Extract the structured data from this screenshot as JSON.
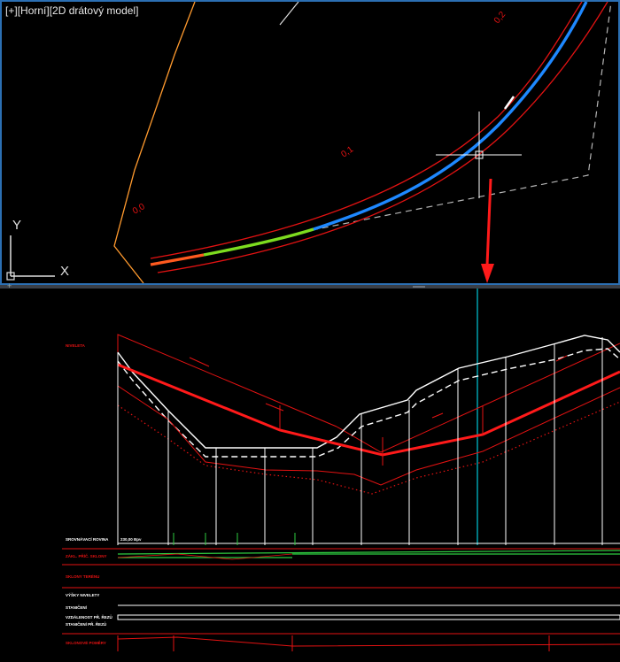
{
  "viewport_top": {
    "label_parts": [
      "[+]",
      "[Horní]",
      "[2D drátový model]"
    ],
    "stations": [
      "0,0",
      "0,1",
      "0,2"
    ],
    "ucs": {
      "y": "Y",
      "x": "X"
    }
  },
  "viewport_bottom": {
    "profile_labels": [
      "SROVNÁVACÍ ROVINA",
      "STANIČENÍ",
      "NIVELETA",
      "SKLONOVÉ POMĚRY",
      "SKLONY TERÉNU",
      "ZÁKL. PŘÍČ. SKLONY",
      "VÝŠKY NIVELETY",
      "VZDÁLENOST PŘ. ŘEZŮ",
      "STANIČENÍ PŘ. ŘEZŮ"
    ],
    "datum_value": "230,00 Bpv"
  },
  "colors": {
    "background": "#000000",
    "viewport_border": "#2b6fb3",
    "alignment_blue": "#1e88ff",
    "alignment_green": "#7ddc1f",
    "alignment_orange": "#ff5a1f",
    "profile_red": "#ff1a1a",
    "terrain_white": "#ffffff",
    "guide_cyan": "#00c8d8",
    "boundary_orange": "#ff9a2e"
  }
}
